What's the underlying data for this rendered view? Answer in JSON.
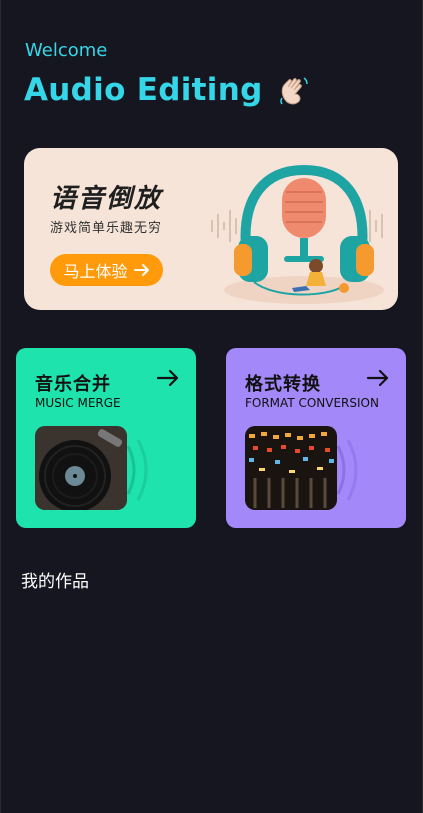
{
  "header": {
    "welcome": "Welcome",
    "title": "Audio Editing",
    "wave_icon": "waving-hand-icon"
  },
  "banner": {
    "title": "语音倒放",
    "subtitle": "游戏简单乐趣无穷",
    "button_label": "马上体验"
  },
  "cards": [
    {
      "title": "音乐合并",
      "subtitle": "MUSIC MERGE",
      "icon": "arrow-right-icon",
      "color": "#1ee3ac"
    },
    {
      "title": "格式转换",
      "subtitle": "FORMAT CONVERSION",
      "icon": "arrow-right-icon",
      "color": "#a288f8"
    }
  ],
  "works": {
    "title": "我的作品"
  },
  "colors": {
    "background": "#161620",
    "accent": "#35d6e7",
    "button": "#ff9b0b"
  }
}
